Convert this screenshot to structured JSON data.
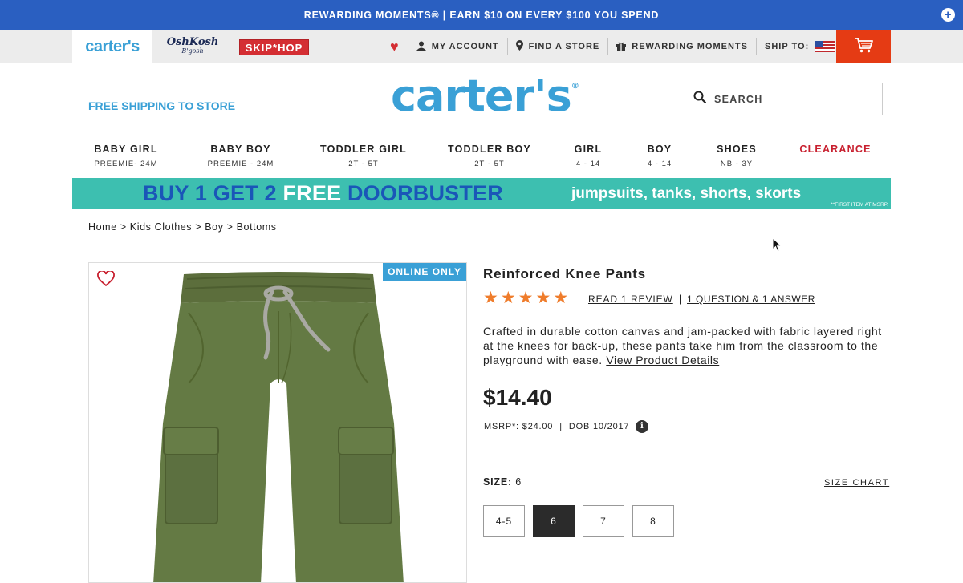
{
  "promo_bar": {
    "text": "REWARDING MOMENTS® | EARN $10 ON EVERY $100 YOU SPEND",
    "expand_icon": "plus-icon"
  },
  "brands": {
    "carters": "carter's",
    "oshkosh": "OshKosh",
    "oshkosh_sub": "B'gosh",
    "skiphop": "SKIP*HOP"
  },
  "utility_nav": {
    "favorites_icon": "heart-icon",
    "my_account": "MY ACCOUNT",
    "find_store": "FIND A STORE",
    "rewarding_moments": "REWARDING MOMENTS",
    "ship_to": "SHIP TO:",
    "ship_to_flag": "us-flag-icon",
    "cart_icon": "cart-icon"
  },
  "header": {
    "free_shipping": "FREE SHIPPING TO STORE",
    "logo": "carter's",
    "logo_mark": "®",
    "search_placeholder": "SEARCH"
  },
  "categories": [
    {
      "title": "BABY GIRL",
      "sub": "PREEMIE- 24M"
    },
    {
      "title": "BABY BOY",
      "sub": "PREEMIE - 24M"
    },
    {
      "title": "TODDLER GIRL",
      "sub": "2T - 5T"
    },
    {
      "title": "TODDLER BOY",
      "sub": "2T - 5T"
    },
    {
      "title": "GIRL",
      "sub": "4 - 14"
    },
    {
      "title": "BOY",
      "sub": "4 - 14"
    },
    {
      "title": "SHOES",
      "sub": "NB - 3Y"
    },
    {
      "title": "CLEARANCE",
      "sub": ""
    }
  ],
  "doorbuster": {
    "part1": "BUY 1 GET 2",
    "free": "FREE",
    "part2": "DOORBUSTER",
    "sub": "jumpsuits, tanks, shorts, skorts",
    "fine_print": "**FIRST ITEM AT MSRP."
  },
  "breadcrumb": "Home > Kids Clothes > Boy > Bottoms",
  "product": {
    "badge": "ONLINE ONLY",
    "title": "Reinforced Knee Pants",
    "rating": 5,
    "read_review": "READ 1 REVIEW",
    "qa": "1 QUESTION &  1 ANSWER",
    "description": "Crafted in durable cotton canvas and jam-packed with fabric layered right at the knees for back-up, these pants take him from the classroom to the playground with ease.",
    "details_link": "View Product Details",
    "price": "$14.40",
    "msrp": "MSRP*: $24.00",
    "dob": "DOB 10/2017",
    "size_label": "SIZE:",
    "size_value": "6",
    "size_chart": "SIZE CHART",
    "sizes": [
      "4-5",
      "6",
      "7",
      "8"
    ],
    "selected_size": "6"
  },
  "colors": {
    "promo_blue": "#2a5fc1",
    "brand_blue": "#3aa0d6",
    "cart_red": "#e53b14",
    "clearance_red": "#c8202f",
    "star_orange": "#ef7c2b",
    "banner_teal": "#3dbfb0"
  }
}
